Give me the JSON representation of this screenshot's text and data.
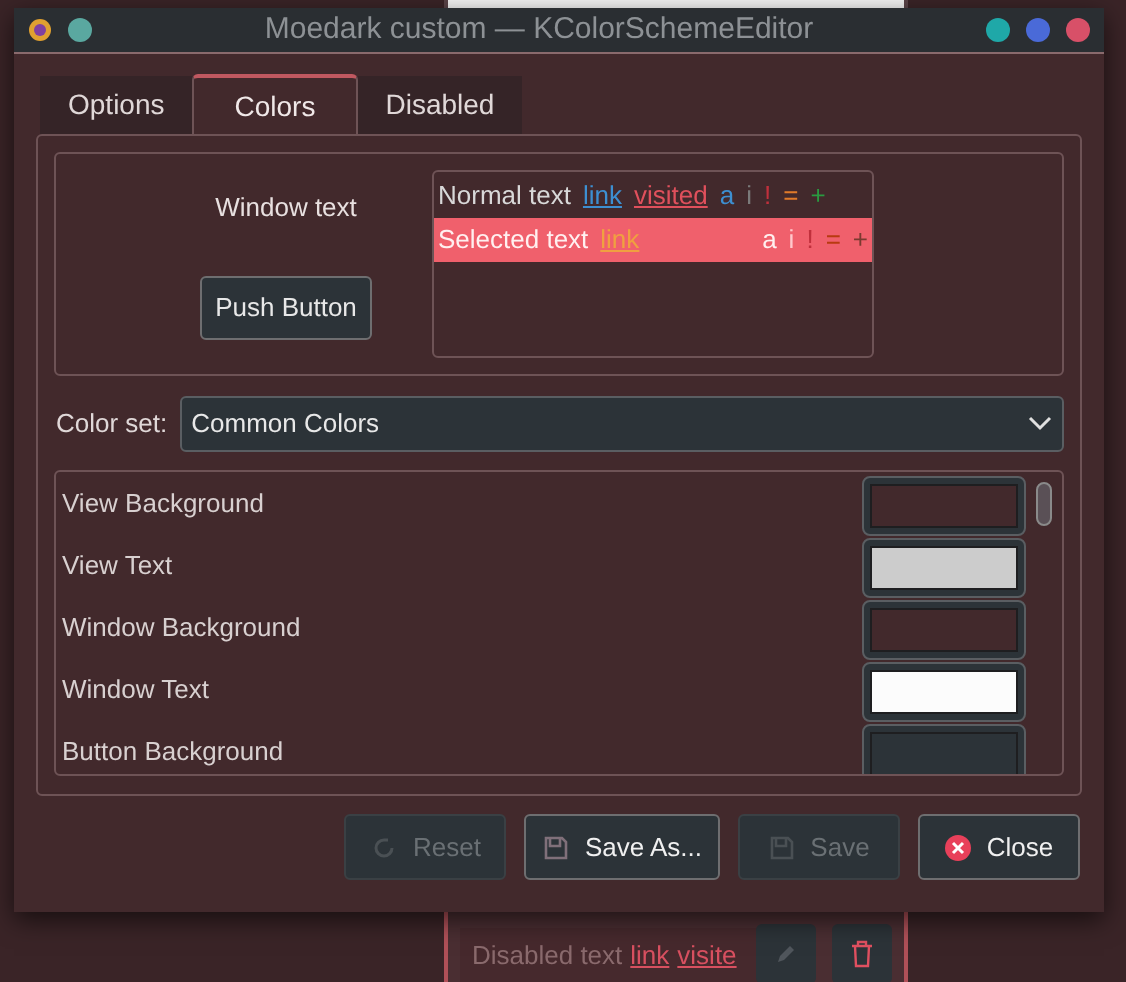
{
  "window": {
    "title": "Moedark custom — KColorSchemeEditor"
  },
  "tabs": [
    {
      "label": "Options",
      "selected": false
    },
    {
      "label": "Colors",
      "selected": true
    },
    {
      "label": "Disabled",
      "selected": false
    }
  ],
  "preview": {
    "window_text": "Window text",
    "push_button": "Push Button",
    "rows": [
      {
        "selected": false,
        "tokens": [
          {
            "kind": "text",
            "text": "Normal text",
            "color": "#d8d8d8"
          },
          {
            "kind": "link",
            "text": "link",
            "color": "#3d8fd1"
          },
          {
            "kind": "link",
            "text": "visited",
            "color": "#e0505c"
          },
          {
            "kind": "text",
            "text": "a",
            "color": "#3d8fd1"
          },
          {
            "kind": "text",
            "text": "i",
            "color": "#7a7a7a"
          },
          {
            "kind": "text",
            "text": "!",
            "color": "#c0303c"
          },
          {
            "kind": "text",
            "text": "=",
            "color": "#e07a2a"
          },
          {
            "kind": "text",
            "text": "+",
            "color": "#2a9a40"
          }
        ]
      },
      {
        "selected": true,
        "tokens": [
          {
            "kind": "text",
            "text": "Selected text",
            "color": "#fff0f0"
          },
          {
            "kind": "link",
            "text": "link",
            "color": "#f0a040"
          },
          {
            "kind": "gap"
          },
          {
            "kind": "text",
            "text": "a",
            "color": "#fff0f0"
          },
          {
            "kind": "text",
            "text": "i",
            "color": "#ffc8cc"
          },
          {
            "kind": "text",
            "text": "!",
            "color": "#c0303c"
          },
          {
            "kind": "text",
            "text": "=",
            "color": "#b83a10"
          },
          {
            "kind": "text",
            "text": "+",
            "color": "#7a3a30"
          }
        ]
      }
    ]
  },
  "color_set": {
    "label": "Color set:",
    "value": "Common Colors"
  },
  "colors": [
    {
      "name": "View Background",
      "color": "#42292c"
    },
    {
      "name": "View Text",
      "color": "#cccccc"
    },
    {
      "name": "Window Background",
      "color": "#42292c"
    },
    {
      "name": "Window Text",
      "color": "#fcfcfc"
    },
    {
      "name": "Button Background",
      "color": "#2c3338"
    }
  ],
  "buttons": [
    {
      "label": "Reset",
      "disabled": true,
      "kind": "reset"
    },
    {
      "label": "Save As...",
      "disabled": false,
      "kind": "save"
    },
    {
      "label": "Save",
      "disabled": true,
      "kind": "save"
    },
    {
      "label": "Close",
      "disabled": false,
      "kind": "close"
    }
  ],
  "background_window": {
    "texts": [
      {
        "kind": "text",
        "text": "Disabled text"
      },
      {
        "kind": "link",
        "text": "link"
      },
      {
        "kind": "link",
        "text": "visite"
      }
    ]
  }
}
